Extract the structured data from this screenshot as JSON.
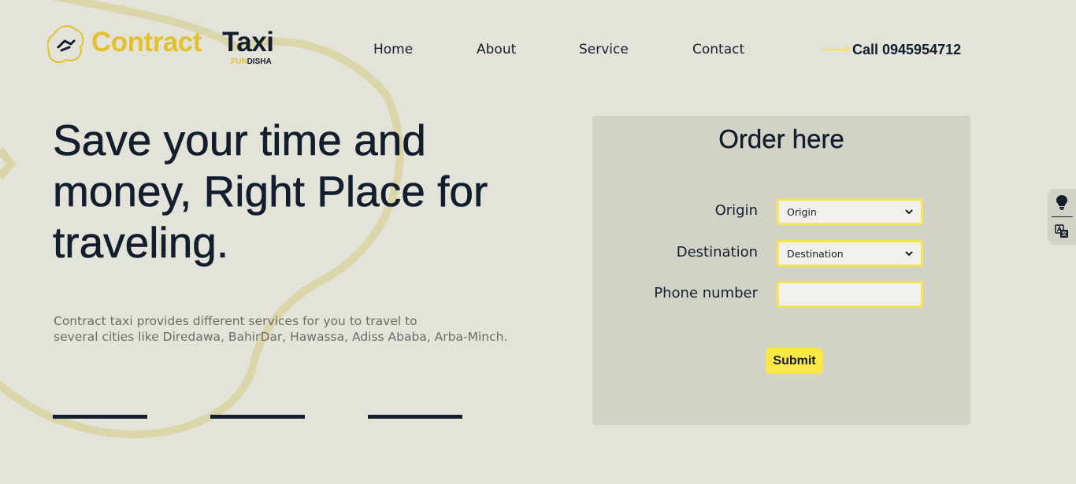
{
  "logo": {
    "word1": "Contract",
    "word2": "Taxi",
    "sub_a": "FUN",
    "sub_b": "DISHA"
  },
  "nav": {
    "home": "Home",
    "about": "About",
    "service": "Service",
    "contact": "Contact",
    "call": "Call 0945954712"
  },
  "hero": {
    "title": "Save your time and money, Right Place for traveling.",
    "desc_line1": "Contract taxi provides different services for you to travel to",
    "desc_line2": "several cities like Diredawa, BahirDar, Hawassa, Adiss Ababa, Arba-Minch."
  },
  "order": {
    "heading": "Order here",
    "origin_label": "Origin",
    "origin_value": "Origin",
    "destination_label": "Destination",
    "destination_value": "Destination",
    "phone_label": "Phone number",
    "phone_value": "",
    "submit": "Submit"
  },
  "side_tools": {
    "top_icon": "lightbulb-icon",
    "bottom_icon": "translate-icon"
  },
  "colors": {
    "background": "#e4e3da",
    "accent_yellow": "#fbe847",
    "logo_yellow": "#e2c12c",
    "dark": "#121e2d",
    "panel": "#d3d2c6"
  }
}
